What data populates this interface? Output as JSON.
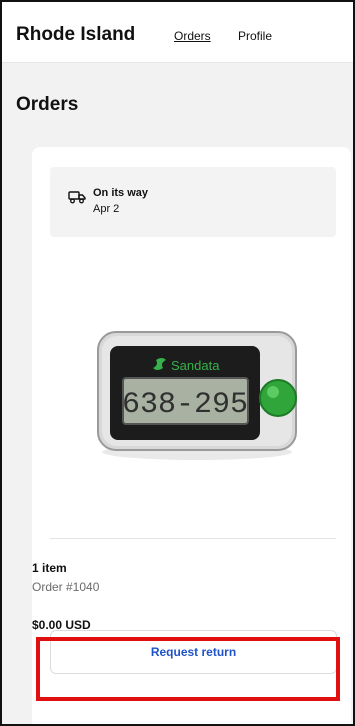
{
  "header": {
    "store_name": "Rhode Island",
    "nav": {
      "orders": "Orders",
      "profile": "Profile"
    }
  },
  "page": {
    "title": "Orders"
  },
  "order": {
    "status": "On its way",
    "date": "Apr 2",
    "product": {
      "brand": "Sandata",
      "display": "638-295",
      "icon": "product-image"
    },
    "item_count": "1 item",
    "order_number": "Order #1040",
    "total": "$0.00 USD",
    "request_return_label": "Request return"
  },
  "colors": {
    "accent_blue": "#1f54c8",
    "highlight_red": "#e01010",
    "device_green": "#2fa53a"
  }
}
